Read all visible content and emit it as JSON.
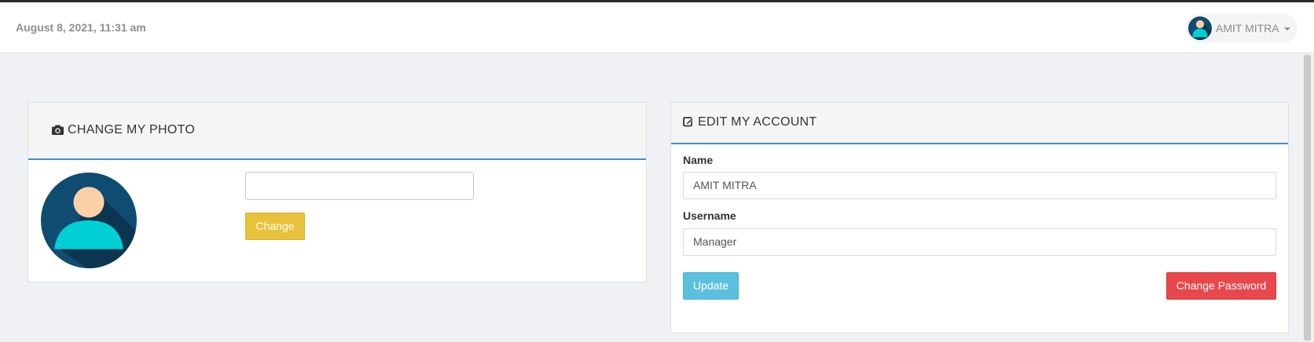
{
  "header": {
    "datetime": "August 8, 2021, 11:31 am",
    "user_name": "AMIT MITRA",
    "user_menu_icon": "chevron-down-icon"
  },
  "photo_panel": {
    "title": "CHANGE MY PHOTO",
    "title_icon": "camera-icon",
    "file_input_value": "",
    "change_label": "Change"
  },
  "account_panel": {
    "title": "EDIT MY ACCOUNT",
    "title_icon": "edit-icon",
    "name_label": "Name",
    "name_value": "AMIT MITRA",
    "username_label": "Username",
    "username_value": "Manager",
    "update_label": "Update",
    "change_password_label": "Change Password"
  },
  "colors": {
    "accent_border": "#3c8dcf",
    "change_button": "#e8c23a",
    "update_button": "#5bc0de",
    "change_password_button": "#e8474c",
    "avatar_bg": "#0f4c72",
    "avatar_body": "#00d0d6",
    "avatar_face": "#fbd0a6"
  }
}
